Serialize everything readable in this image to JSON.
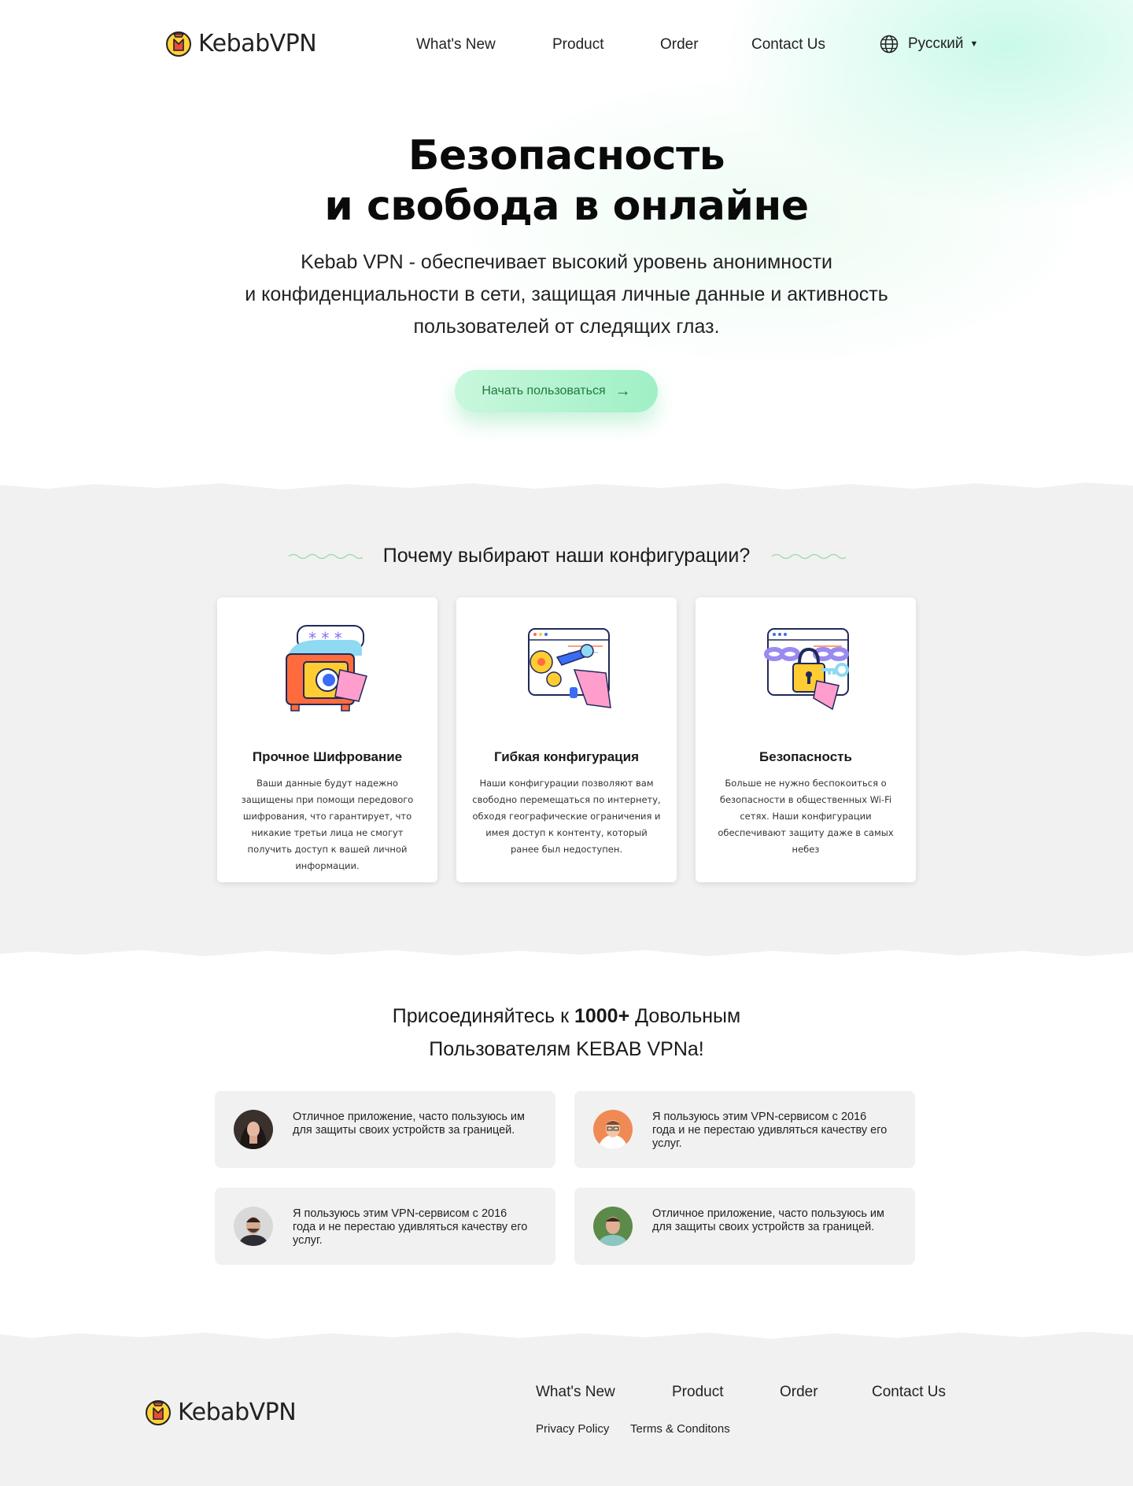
{
  "brand": {
    "name": "KebabVPN"
  },
  "nav": {
    "items": [
      "What's New",
      "Product",
      "Order",
      "Contact Us"
    ],
    "language": "Русский"
  },
  "hero": {
    "title_line1": "Безопасность",
    "title_line2": "и свобода в онлайне",
    "sub_line1": "Kebab VPN - обеспечивает высокий уровень анонимности",
    "sub_line2": "и конфиденциальности в сети, защищая личные данные и активность",
    "sub_line3": "пользователей от следящих глаз.",
    "cta_label": "Начать пользоваться"
  },
  "features": {
    "title": "Почему выбирают наши конфигурации?",
    "cards": [
      {
        "title": "Прочное Шифрование",
        "icon": "safe-encryption-icon",
        "text": "Ваши данные будут надежно защищены при помощи передового шифрования, что гарантирует,  что никакие третьи лица не смогут получить доступ к вашей личной информации."
      },
      {
        "title": "Гибкая конфигурация",
        "icon": "gears-wrench-icon",
        "text": "Наши конфигурации позволяют вам свободно перемещаться по интернету, обходя географические ограничения и имея доступ к контенту, который ранее был недоступен."
      },
      {
        "title": "Безопасность",
        "icon": "chain-lock-icon",
        "text": "Больше не нужно беспокоиться о безопасности в общественных Wi-Fi сетях. Наши конфигурации обеспечивают защиту даже в самых небез"
      }
    ]
  },
  "testimonials": {
    "heading_pre": "Присоединяйтесь к ",
    "heading_bold": "1000+",
    "heading_post": " Довольным",
    "heading_line2": "Пользователям KEBAB VPNa!",
    "items": [
      {
        "text": "Отличное приложение, часто пользуюсь им для защиты своих устройств за границей."
      },
      {
        "text": "Я пользуюсь этим VPN-сервисом с 2016 года и не перестаю удивляться качеству его услуг."
      },
      {
        "text": "Я пользуюсь этим VPN-сервисом с 2016 года и не перестаю удивляться качеству его услуг."
      },
      {
        "text": "Отличное приложение, часто пользуюсь им для защиты своих устройств за границей."
      }
    ]
  },
  "footer": {
    "links": [
      "What's New",
      "Product",
      "Order",
      "Contact Us"
    ],
    "privacy": "Privacy Policy",
    "terms": "Terms & Conditons"
  },
  "colors": {
    "cta_text": "#1f7a3e",
    "cta_bg": "#a8f2cb",
    "band_bg": "#f1f1f1"
  }
}
